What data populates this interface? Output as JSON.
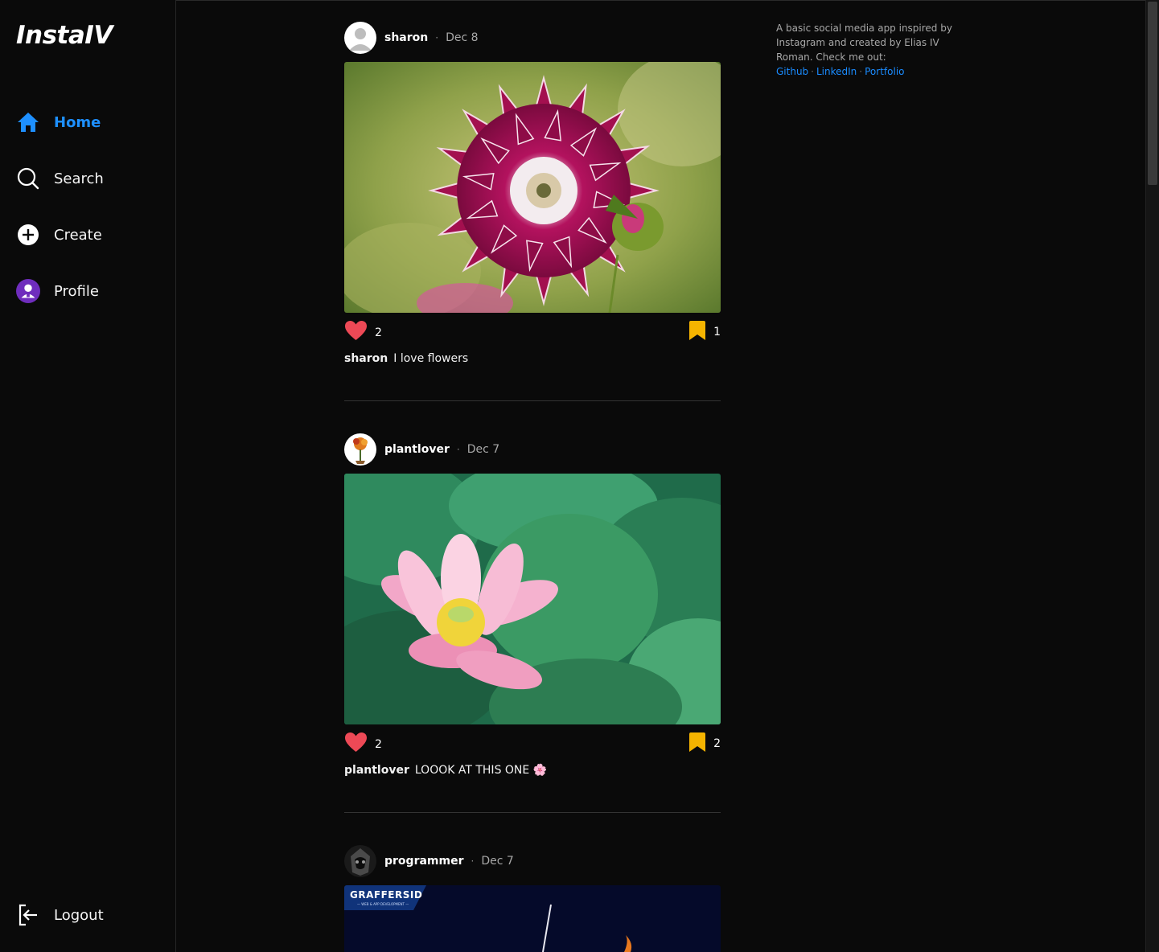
{
  "app": {
    "logo": "InstaIV"
  },
  "nav": {
    "items": [
      {
        "label": "Home",
        "icon": "home-icon",
        "active": true
      },
      {
        "label": "Search",
        "icon": "search-icon"
      },
      {
        "label": "Create",
        "icon": "plus-circle-icon"
      },
      {
        "label": "Profile",
        "icon": "profile-avatar-icon"
      }
    ],
    "logout": "Logout"
  },
  "posts": [
    {
      "user": "sharon",
      "sep": "·",
      "date": "Dec 8",
      "likes": "2",
      "saves": "1",
      "caption": "I love flowers",
      "image": "pink-dahlia-photo"
    },
    {
      "user": "plantlover",
      "sep": "·",
      "date": "Dec 7",
      "likes": "2",
      "saves": "2",
      "caption": "LOOOK AT THIS ONE 🌸",
      "image": "pink-lotus-photo"
    },
    {
      "user": "programmer",
      "sep": "·",
      "date": "Dec 7",
      "image": "graffersid-banner",
      "banner_text": "GRAFFERSID",
      "banner_sub": "— WEB & APP DEVELOPMENT —"
    }
  ],
  "aside": {
    "text": "A basic social media app inspired by Instagram and created by Elias IV Roman. Check me out:",
    "links": [
      "Github",
      "LinkedIn",
      "Portfolio"
    ],
    "sep": "·"
  },
  "colors": {
    "accent": "#1e90ff",
    "like": "#ed4956",
    "save": "#f5b400",
    "bg": "#0a0a0a"
  }
}
